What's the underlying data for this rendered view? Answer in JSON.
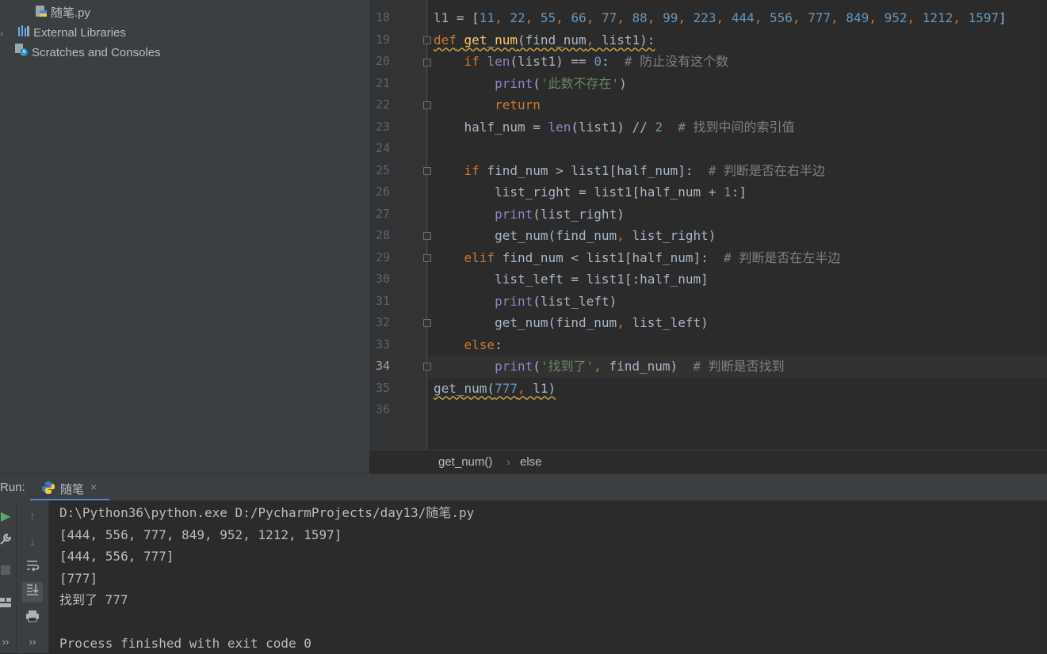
{
  "project_tree": [
    {
      "label": "随笔.py",
      "icon": "python-file-icon"
    },
    {
      "label": "External Libraries",
      "icon": "library-icon"
    },
    {
      "label": "Scratches and Consoles",
      "icon": "scratches-icon"
    }
  ],
  "editor": {
    "line_numbers": [
      "18",
      "19",
      "20",
      "21",
      "22",
      "23",
      "24",
      "25",
      "26",
      "27",
      "28",
      "29",
      "30",
      "31",
      "32",
      "33",
      "34",
      "35",
      "36"
    ],
    "current_line": "34",
    "lines": [
      "l1 = [11, 22, 55, 66, 77, 88, 99, 223, 444, 556, 777, 849, 952, 1212, 1597]",
      "def get_num(find_num, list1):",
      "    if len(list1) == 0:  # 防止没有这个数",
      "        print('此数不存在')",
      "        return",
      "    half_num = len(list1) // 2  # 找到中间的索引值",
      "",
      "    if find_num > list1[half_num]:  # 判断是否在右半边",
      "        list_right = list1[half_num + 1:]",
      "        print(list_right)",
      "        get_num(find_num, list_right)",
      "    elif find_num < list1[half_num]:  # 判断是否在左半边",
      "        list_left = list1[:half_num]",
      "        print(list_left)",
      "        get_num(find_num, list_left)",
      "    else:",
      "        print('找到了', find_num)  # 判断是否找到",
      "get_num(777, l1)",
      ""
    ]
  },
  "breadcrumbs": {
    "first": "get_num()",
    "separator": "›",
    "second": "else"
  },
  "run": {
    "label": "Run:",
    "tab_name": "随笔",
    "close": "×",
    "output": [
      "D:\\Python36\\python.exe D:/PycharmProjects/day13/随笔.py",
      "[444, 556, 777, 849, 952, 1212, 1597]",
      "[444, 556, 777]",
      "[777]",
      "找到了 777",
      "",
      "Process finished with exit code 0"
    ]
  },
  "colors": {
    "keyword": "#cc7832",
    "number": "#6897bb",
    "string": "#6a8759",
    "comment": "#808080",
    "builtin": "#8888c6",
    "function": "#ffc66d",
    "accent": "#4a88c7"
  }
}
